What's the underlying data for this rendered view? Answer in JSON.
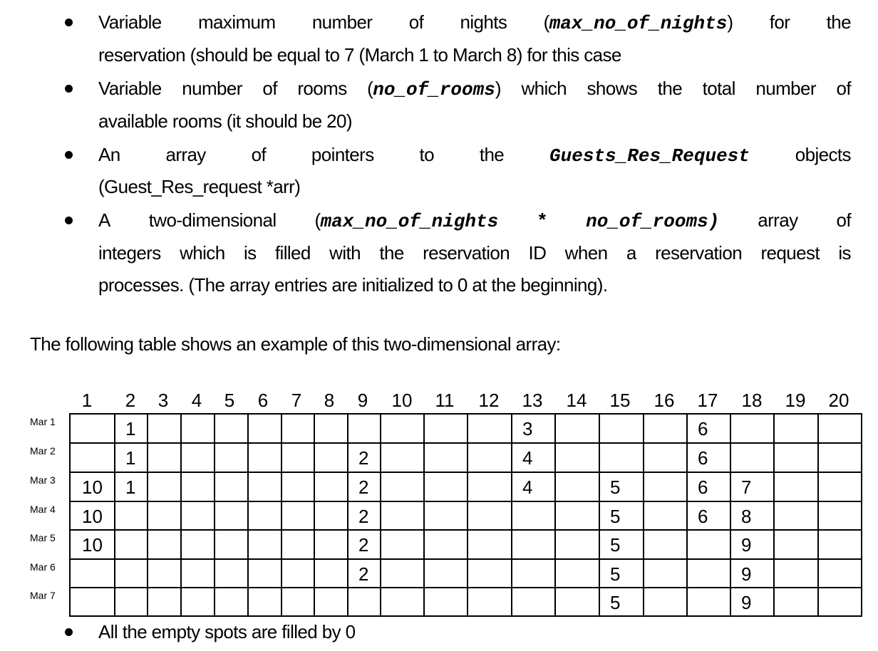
{
  "bullets": [
    {
      "lines": [
        {
          "justified": true,
          "parts": [
            {
              "t": "Variable"
            },
            {
              "t": "maximum"
            },
            {
              "t": "number"
            },
            {
              "t": "of"
            },
            {
              "t": "nights"
            },
            {
              "t": "(",
              "code": "max_no_of_nights",
              "after": ")"
            },
            {
              "t": "for"
            },
            {
              "t": "the"
            }
          ]
        },
        {
          "text": "reservation (should be equal to 7 (March 1 to March 8) for this case"
        }
      ]
    },
    {
      "lines": [
        {
          "justified": true,
          "parts": [
            {
              "t": "Variable"
            },
            {
              "t": "number"
            },
            {
              "t": "of"
            },
            {
              "t": "rooms"
            },
            {
              "t": "(",
              "code": "no_of_rooms",
              "after": ")"
            },
            {
              "t": "which"
            },
            {
              "t": "shows"
            },
            {
              "t": "the"
            },
            {
              "t": "total"
            },
            {
              "t": "number"
            },
            {
              "t": "of"
            }
          ]
        },
        {
          "text": "available rooms (it should be 20)"
        }
      ]
    },
    {
      "lines": [
        {
          "justified": true,
          "parts": [
            {
              "t": "An"
            },
            {
              "t": "array"
            },
            {
              "t": "of"
            },
            {
              "t": "pointers"
            },
            {
              "t": "to"
            },
            {
              "t": "the"
            },
            {
              "t": "",
              "code": "Guests_Res_Request",
              "after": ""
            },
            {
              "t": "objects"
            }
          ]
        },
        {
          "text": "(Guest_Res_request *arr)"
        }
      ]
    },
    {
      "lines": [
        {
          "justified": true,
          "parts": [
            {
              "t": "A"
            },
            {
              "t": "two-dimensional"
            },
            {
              "t": "(",
              "code": "max_no_of_nights",
              "after": ""
            },
            {
              "t": "",
              "code": "*",
              "after": ""
            },
            {
              "t": "",
              "code": "no_of_rooms)",
              "after": ""
            },
            {
              "t": "array"
            },
            {
              "t": "of"
            }
          ]
        },
        {
          "justified": true,
          "parts": [
            {
              "t": "integers"
            },
            {
              "t": "which"
            },
            {
              "t": "is"
            },
            {
              "t": "filled"
            },
            {
              "t": "with"
            },
            {
              "t": "the"
            },
            {
              "t": "reservation"
            },
            {
              "t": "ID"
            },
            {
              "t": "when"
            },
            {
              "t": "a"
            },
            {
              "t": "reservation"
            },
            {
              "t": "request"
            },
            {
              "t": "is"
            }
          ]
        },
        {
          "text": "processes. (The array entries are initialized to 0 at the beginning)."
        }
      ]
    }
  ],
  "heading": "The following table shows an example of this two-dimensional array:",
  "table": {
    "column_headers": [
      "1",
      "2",
      "3",
      "4",
      "5",
      "6",
      "7",
      "8",
      "9",
      "10",
      "11",
      "12",
      "13",
      "14",
      "15",
      "16",
      "17",
      "18",
      "19",
      "20"
    ],
    "row_labels": [
      "Mar 1",
      "Mar 2",
      "Mar 3",
      "Mar 4",
      "Mar 5",
      "Mar 6",
      "Mar 7"
    ],
    "rows": [
      [
        "",
        "1",
        "",
        "",
        "",
        "",
        "",
        "",
        "",
        "",
        "",
        "",
        "3",
        "",
        "",
        "",
        "6",
        "",
        "",
        ""
      ],
      [
        "",
        "1",
        "",
        "",
        "",
        "",
        "",
        "",
        "2",
        "",
        "",
        "",
        "4",
        "",
        "",
        "",
        "6",
        "",
        "",
        ""
      ],
      [
        "10",
        "1",
        "",
        "",
        "",
        "",
        "",
        "",
        "2",
        "",
        "",
        "",
        "4",
        "",
        "5",
        "",
        "6",
        "7",
        "",
        ""
      ],
      [
        "10",
        "",
        "",
        "",
        "",
        "",
        "",
        "",
        "2",
        "",
        "",
        "",
        "",
        "",
        "5",
        "",
        "6",
        "8",
        "",
        ""
      ],
      [
        "10",
        "",
        "",
        "",
        "",
        "",
        "",
        "",
        "2",
        "",
        "",
        "",
        "",
        "",
        "5",
        "",
        "",
        "9",
        "",
        ""
      ],
      [
        "",
        "",
        "",
        "",
        "",
        "",
        "",
        "",
        "2",
        "",
        "",
        "",
        "",
        "",
        "5",
        "",
        "",
        "9",
        "",
        ""
      ],
      [
        "",
        "",
        "",
        "",
        "",
        "",
        "",
        "",
        "",
        "",
        "",
        "",
        "",
        "",
        "5",
        "",
        "",
        "9",
        "",
        ""
      ]
    ]
  },
  "footer_bullet": "All the empty spots are filled by 0"
}
